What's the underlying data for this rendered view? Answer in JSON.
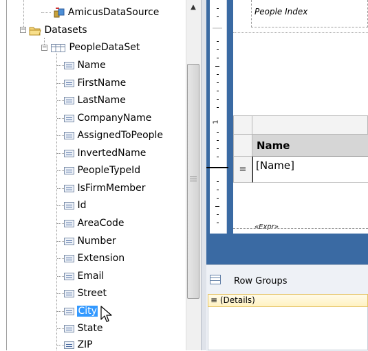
{
  "tree": {
    "datasource_label": "AmicusDataSource",
    "datasets_label": "Datasets",
    "dataset_label": "PeopleDataSet",
    "fields": [
      "Name",
      "FirstName",
      "LastName",
      "CompanyName",
      "AssignedToPeople",
      "InvertedName",
      "PeopleTypeId",
      "IsFirmMember",
      "Id",
      "AreaCode",
      "Number",
      "Extension",
      "Email",
      "Street",
      "City",
      "State",
      "ZIP"
    ],
    "selected_field": "City"
  },
  "report": {
    "header_title": "People Index",
    "ruler_digit": "1",
    "column_header": "Name",
    "detail_expression": "[Name]",
    "row_handle_glyph": "≡",
    "footer_expr": "«Expr»"
  },
  "groups": {
    "title": "Row Groups",
    "details_item": "≡ (Details)"
  },
  "colors": {
    "design_background": "#3a6aa3",
    "selection": "#3399ff",
    "details_highlight": "#fff2c2"
  }
}
